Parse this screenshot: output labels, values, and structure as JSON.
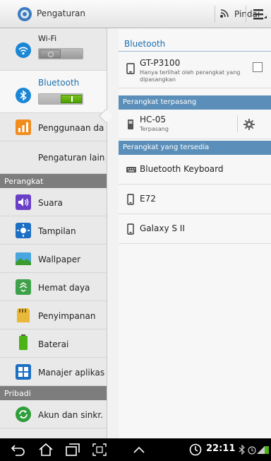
{
  "actionbar": {
    "title": "Pengaturan",
    "scan_label": "Pindai"
  },
  "left_menu": {
    "wifi_label": "Wi-Fi",
    "bluetooth_label": "Bluetooth",
    "data_usage_label": "Penggunaan da",
    "more_settings_label": "Pengaturan lain",
    "section_device": "Perangkat",
    "sound_label": "Suara",
    "display_label": "Tampilan",
    "wallpaper_label": "Wallpaper",
    "power_saving_label": "Hemat daya",
    "storage_label": "Penyimpanan",
    "battery_label": "Baterai",
    "app_manager_label": "Manajer aplikas",
    "section_personal": "Pribadi",
    "accounts_label": "Akun dan sinkr."
  },
  "right_panel": {
    "title": "Bluetooth",
    "device_name": "GT-P3100",
    "device_visibility": "Hanya terlihat oleh perangkat yang dipasangkan",
    "paired_header": "Perangkat terpasang",
    "paired_devices": [
      {
        "name": "HC-05",
        "status": "Terpasang"
      }
    ],
    "available_header": "Perangkat yang tersedia",
    "available_devices": [
      {
        "name": "Bluetooth Keyboard"
      },
      {
        "name": "E72"
      },
      {
        "name": "Galaxy S II"
      }
    ]
  },
  "statusbar": {
    "time": "22:11"
  },
  "colors": {
    "accent_blue": "#1d6fae",
    "section_blue": "#5b8fb9",
    "toggle_on": "#49a000"
  }
}
